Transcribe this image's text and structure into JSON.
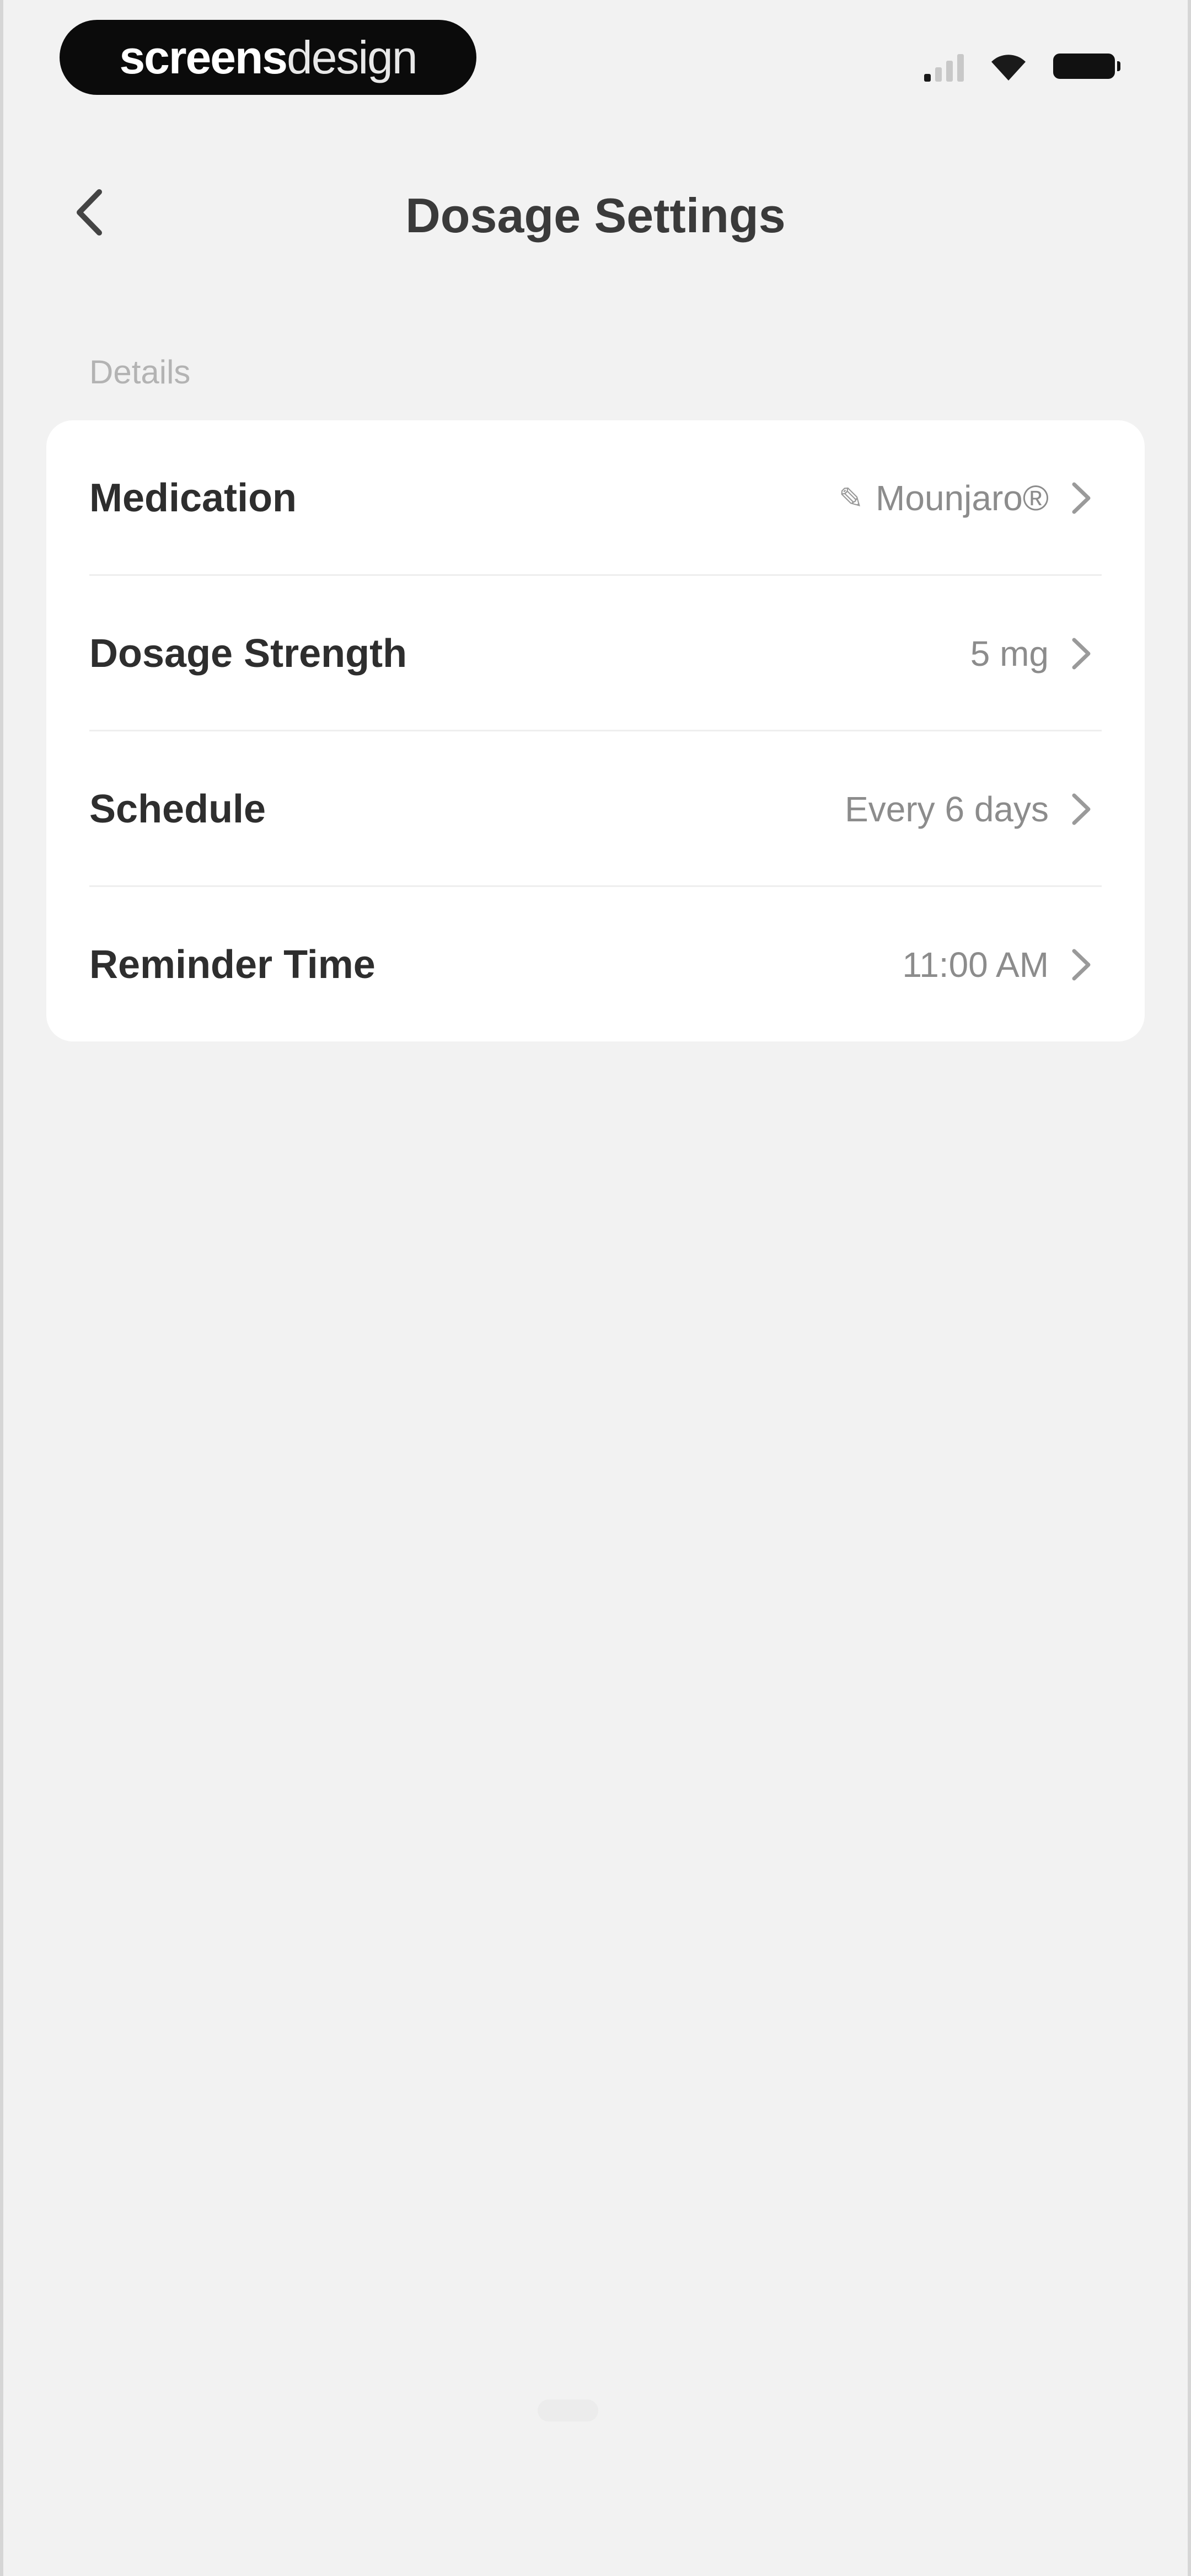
{
  "status_bar": {
    "brand_bold": "screens",
    "brand_light": "design"
  },
  "header": {
    "title": "Dosage Settings",
    "back_icon": "chevron-left-icon"
  },
  "section": {
    "label": "Details"
  },
  "rows": [
    {
      "label": "Medication",
      "value": "Mounjaro®",
      "icon": "pencil-icon"
    },
    {
      "label": "Dosage Strength",
      "value": "5 mg"
    },
    {
      "label": "Schedule",
      "value": "Every 6 days"
    },
    {
      "label": "Reminder Time",
      "value": "11:00 AM"
    }
  ],
  "colors": {
    "background": "#f2f2f2",
    "card": "#ffffff",
    "label": "#2e2e2e",
    "value": "#8c8c8c",
    "section_label": "#b3b3b3"
  }
}
